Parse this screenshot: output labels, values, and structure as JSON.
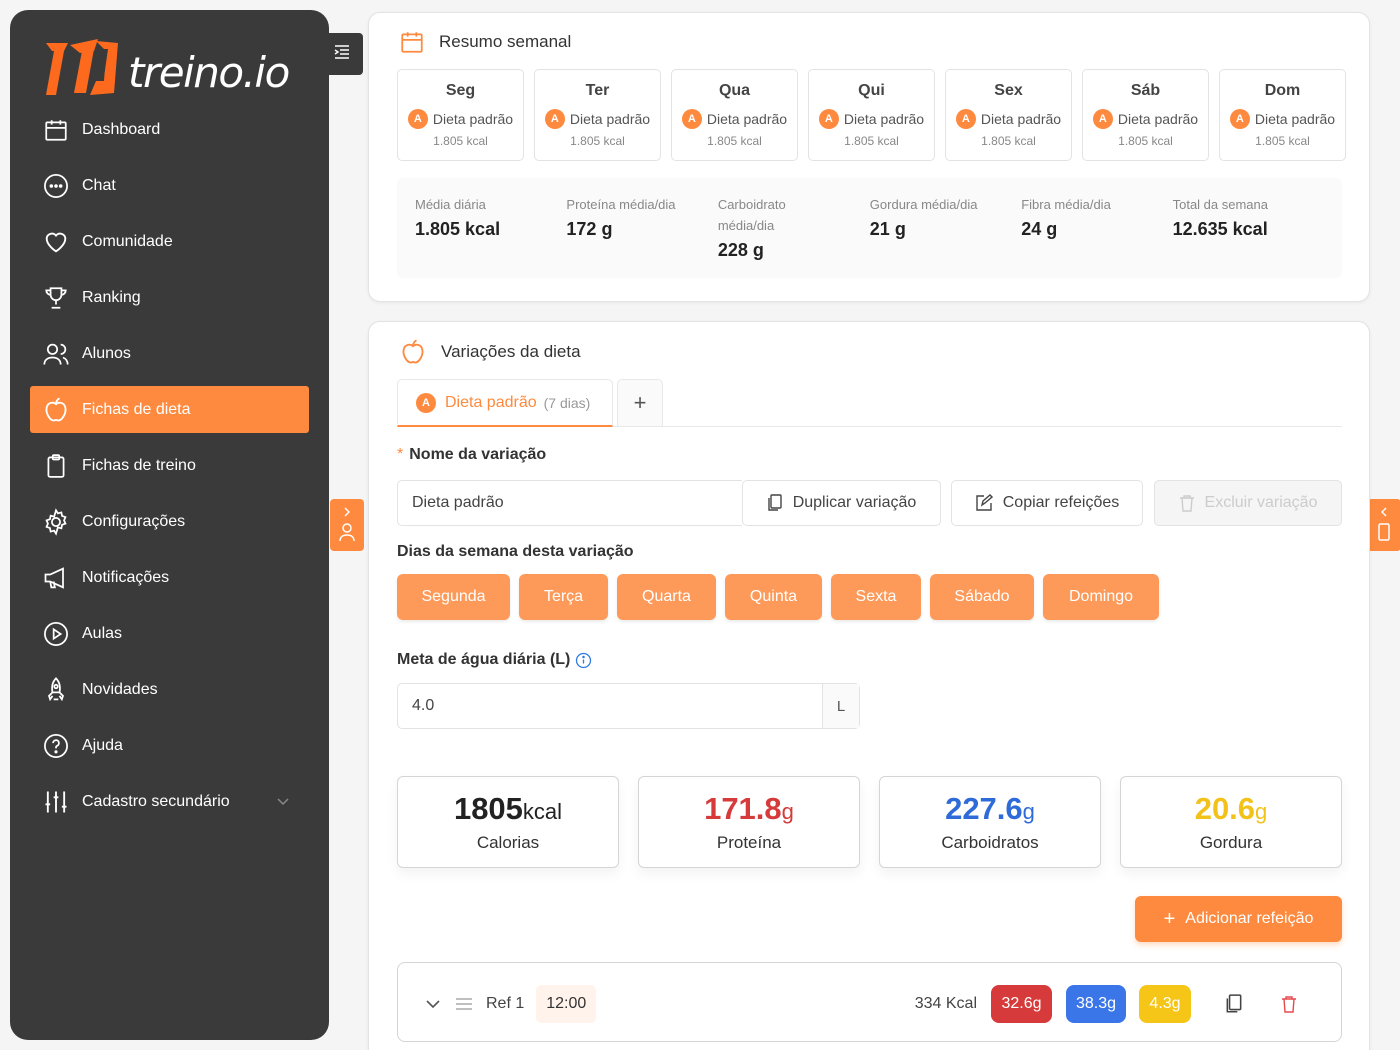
{
  "brand": {
    "name": "treino.io",
    "accent": "#fd8a3e",
    "sidebar_bg": "#3a3a3a"
  },
  "sidebar": {
    "items": [
      {
        "label": "Dashboard",
        "icon": "calendar-icon"
      },
      {
        "label": "Chat",
        "icon": "chat-bubble-icon"
      },
      {
        "label": "Comunidade",
        "icon": "heart-icon"
      },
      {
        "label": "Ranking",
        "icon": "trophy-icon"
      },
      {
        "label": "Alunos",
        "icon": "users-icon"
      },
      {
        "label": "Fichas de dieta",
        "icon": "apple-icon",
        "active": true
      },
      {
        "label": "Fichas de treino",
        "icon": "clipboard-icon"
      },
      {
        "label": "Configurações",
        "icon": "gear-icon"
      },
      {
        "label": "Notificações",
        "icon": "megaphone-icon"
      },
      {
        "label": "Aulas",
        "icon": "play-circle-icon"
      },
      {
        "label": "Novidades",
        "icon": "rocket-icon"
      },
      {
        "label": "Ajuda",
        "icon": "help-icon"
      },
      {
        "label": "Cadastro secundário",
        "icon": "sliders-icon",
        "expandable": true
      }
    ]
  },
  "summary": {
    "title": "Resumo semanal",
    "days": [
      {
        "name": "Seg",
        "badge": "A",
        "diet": "Dieta padrão",
        "kcal": "1.805 kcal"
      },
      {
        "name": "Ter",
        "badge": "A",
        "diet": "Dieta padrão",
        "kcal": "1.805 kcal"
      },
      {
        "name": "Qua",
        "badge": "A",
        "diet": "Dieta padrão",
        "kcal": "1.805 kcal"
      },
      {
        "name": "Qui",
        "badge": "A",
        "diet": "Dieta padrão",
        "kcal": "1.805 kcal"
      },
      {
        "name": "Sex",
        "badge": "A",
        "diet": "Dieta padrão",
        "kcal": "1.805 kcal"
      },
      {
        "name": "Sáb",
        "badge": "A",
        "diet": "Dieta padrão",
        "kcal": "1.805 kcal"
      },
      {
        "name": "Dom",
        "badge": "A",
        "diet": "Dieta padrão",
        "kcal": "1.805 kcal"
      }
    ],
    "stats": [
      {
        "label": "Média diária",
        "value": "1.805 kcal"
      },
      {
        "label": "Proteína média/dia",
        "value": "172 g"
      },
      {
        "label": "Carboidrato média/dia",
        "value": "228 g"
      },
      {
        "label": "Gordura média/dia",
        "value": "21 g"
      },
      {
        "label": "Fibra média/dia",
        "value": "24 g"
      },
      {
        "label": "Total da semana",
        "value": "12.635 kcal"
      }
    ]
  },
  "variations": {
    "title": "Variações da dieta",
    "tab": {
      "badge": "A",
      "label": "Dieta padrão",
      "count": "(7 dias)"
    },
    "add_tab": "+",
    "name_label": "Nome da variação",
    "name_required_mark": "*",
    "name_value": "Dieta padrão",
    "duplicate_label": "Duplicar variação",
    "copy_label": "Copiar refeições",
    "delete_label": "Excluir variação",
    "weekdays_label": "Dias da semana desta variação",
    "weekdays": [
      "Segunda",
      "Terça",
      "Quarta",
      "Quinta",
      "Sexta",
      "Sábado",
      "Domingo"
    ],
    "water_label": "Meta de água diária (L)",
    "water_value": "4.0",
    "water_unit": "L",
    "macros": [
      {
        "value": "1805",
        "unit": "kcal",
        "label": "Calorias",
        "color": "#333333"
      },
      {
        "value": "171.8",
        "unit": "g",
        "label": "Proteína",
        "color": "#d63a3a"
      },
      {
        "value": "227.6",
        "unit": "g",
        "label": "Carboidratos",
        "color": "#2f6bd8"
      },
      {
        "value": "20.6",
        "unit": "g",
        "label": "Gordura",
        "color": "#f2c21b"
      }
    ],
    "add_meal_label": "Adicionar refeição",
    "add_meal_plus": "+",
    "meal": {
      "name": "Ref 1",
      "time": "12:00",
      "kcal": "334 Kcal",
      "protein": "32.6g",
      "carbs": "38.3g",
      "fat": "4.3g",
      "protein_color": "#d63a3a",
      "carbs_color": "#3b76e8",
      "fat_color": "#f5c518"
    }
  }
}
